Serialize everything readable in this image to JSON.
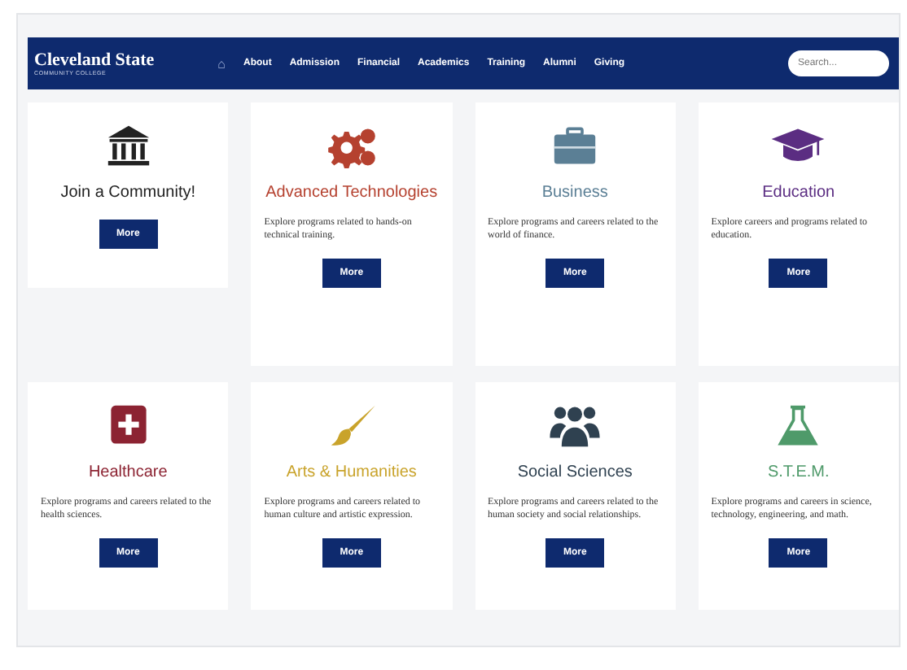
{
  "header": {
    "logo_title": "Cleveland State",
    "logo_subtitle": "COMMUNITY COLLEGE",
    "home": "⌂",
    "nav": [
      {
        "label": "About"
      },
      {
        "label": "Admission"
      },
      {
        "label": "Financial"
      },
      {
        "label": "Academics"
      },
      {
        "label": "Training"
      },
      {
        "label": "Alumni"
      },
      {
        "label": "Giving"
      }
    ],
    "search": {
      "placeholder": "Search..."
    }
  },
  "cards": [
    {
      "kind": "bank",
      "title": "Join a Community!",
      "color": "#222222",
      "button": "More"
    },
    {
      "kind": "gears",
      "title": "Advanced Technologies",
      "color": "#b5412f",
      "description": "Explore programs related to hands-on technical training.",
      "button": "More"
    },
    {
      "kind": "briefcase",
      "title": "Business",
      "color": "#5b7f95",
      "description": "Explore programs and careers related to the world of finance.",
      "button": "More"
    },
    {
      "kind": "cap",
      "title": "Education",
      "color": "#5b2d82",
      "description": "Explore careers and programs related to education.",
      "button": "More"
    },
    {
      "kind": "cross",
      "title": "Healthcare",
      "color": "#8c2332",
      "description": "Explore programs and careers related to the health sciences.",
      "button": "More"
    },
    {
      "kind": "brush",
      "title": "Arts & Humanities",
      "color": "#c9a32b",
      "description": "Explore programs and careers related to human culture and artistic expression.",
      "button": "More"
    },
    {
      "kind": "people",
      "title": "Social Sciences",
      "color": "#2f4150",
      "description": "Explore programs and careers related to the human society and social relationships.",
      "button": "More"
    },
    {
      "kind": "flask",
      "title": "S.T.E.M.",
      "color": "#4f9a6a",
      "description": "Explore programs and careers in science, technology, engineering, and math.",
      "button": "More"
    }
  ]
}
